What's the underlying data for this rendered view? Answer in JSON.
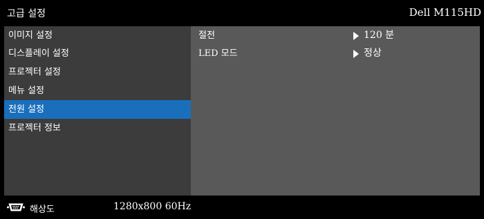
{
  "header": {
    "title": "고급 설정",
    "model": "Dell M115HD"
  },
  "menu": {
    "items": [
      {
        "label": "이미지 설정"
      },
      {
        "label": "디스플레이 설정"
      },
      {
        "label": "프로젝터 설정"
      },
      {
        "label": "메뉴 설정"
      },
      {
        "label": "전원 설정",
        "selected": true
      },
      {
        "label": "프로젝터 정보"
      }
    ]
  },
  "content": {
    "rows": [
      {
        "label": "절전",
        "value": "120 분"
      },
      {
        "label": "LED 모드",
        "value": "정상"
      }
    ]
  },
  "status": {
    "icon": "vga-connector-icon",
    "label": "해상도",
    "value": "1280x800 60Hz"
  },
  "colors": {
    "selected": "#1a6fbd",
    "menu_bg": "#3c3c3c",
    "content_bg": "#595959",
    "bar_bg": "#000000"
  }
}
